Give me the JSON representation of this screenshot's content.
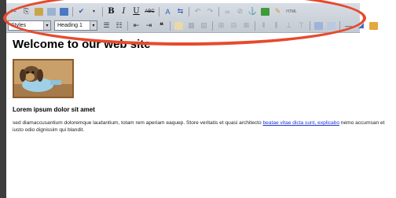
{
  "toolbar": {
    "styles_select": "Styles",
    "format_select": "Heading 1",
    "bold": "B",
    "italic": "I",
    "underline": "U",
    "strikethrough": "ABC",
    "html_button": "HTML"
  },
  "document": {
    "title": "Welcome to our web site",
    "subheading": "Lorem ipsum dolor sit amet",
    "paragraph_text": "sed diamaccusantium doloremque laudantium, totam rem aperiam eaquep. Store veritatis et quasi architecto ",
    "paragraph_link": "beatae vitae dicta sunt, explicabo",
    "paragraph_after": " nemo accumsan et iusto odio dignissim qui blandit."
  },
  "colors": {
    "highlight_ring": "#e64a2e",
    "link": "#1a36d6",
    "toolbar_bg": "#c9ced6"
  }
}
